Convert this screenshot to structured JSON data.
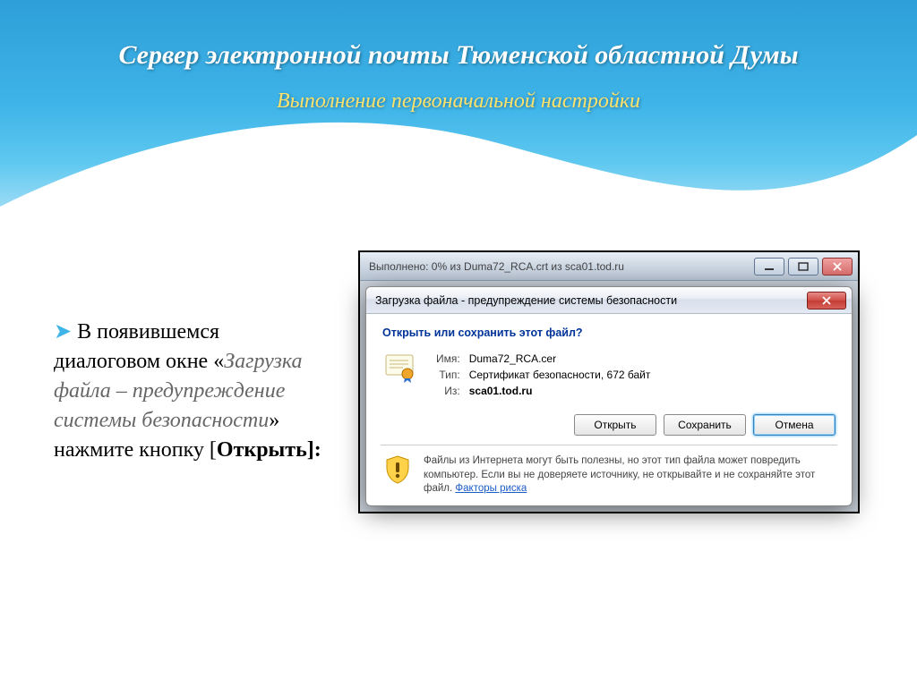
{
  "slide": {
    "title": "Сервер электронной почты Тюменской областной Думы",
    "subtitle": "Выполнение первоначальной настройки"
  },
  "instruction": {
    "lead": "В появившемся диалоговом окне «",
    "dialog_name": "Загрузка файла – предупреждение системы безопасности",
    "mid": "» нажмите кнопку [",
    "button": "Открыть",
    "tail": "]:"
  },
  "window": {
    "title": "Выполнено: 0% из Duma72_RCA.crt из sca01.tod.ru"
  },
  "dialog": {
    "title": "Загрузка файла - предупреждение системы безопасности",
    "question": "Открыть или сохранить этот файл?",
    "labels": {
      "name": "Имя:",
      "type": "Тип:",
      "from": "Из:"
    },
    "values": {
      "name": "Duma72_RCA.cer",
      "type": "Сертификат безопасности, 672 байт",
      "from": "sca01.tod.ru"
    },
    "buttons": {
      "open": "Открыть",
      "save": "Сохранить",
      "cancel": "Отмена"
    },
    "warning_text": "Файлы из Интернета могут быть полезны, но этот тип файла может повредить компьютер. Если вы не доверяете источнику, не открывайте и не сохраняйте этот файл. ",
    "warning_link": "Факторы риска"
  }
}
